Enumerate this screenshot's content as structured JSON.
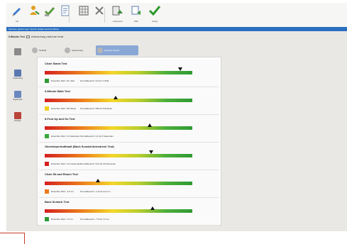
{
  "toolbar": {
    "buttons": [
      {
        "icon": "edit-pencil-icon",
        "label": "Hil",
        "color": "#3f7ccf"
      },
      {
        "icon": "patient-icon",
        "label": "",
        "color": "#e0a020"
      },
      {
        "icon": "select-icon",
        "label": "",
        "color": "#5a9a40"
      },
      {
        "icon": "document-icon",
        "label": "",
        "color": "#6a8ab0"
      },
      {
        "icon": "grid-icon",
        "label": "",
        "color": "#8a8a8a"
      },
      {
        "icon": "close-icon",
        "label": "",
        "color": "#7a7a7a"
      },
      {
        "icon": "assessment-icon",
        "label": "Untersuch.",
        "color": "#3a8a3a"
      },
      {
        "icon": "export-icon",
        "label": "PDF",
        "color": "#5a7ab0"
      },
      {
        "icon": "confirm-check-icon",
        "label": "Fertig",
        "color": "#2e9a2e"
      }
    ]
  },
  "titlebar": {
    "text": "Senioren gestern ago. Test für Heilige Hermine Bauer"
  },
  "recordbar": {
    "icon": "record-icon",
    "label": "6 Minuten Test",
    "subtitle": "Untersuchung zuletzt am heute"
  },
  "sidebar": {
    "items": [
      {
        "label": "",
        "icon": "patient-icon",
        "color": "#8a8a8a"
      },
      {
        "label": "Anwendung",
        "icon": "assessment-icon",
        "color": "#5b78b0"
      },
      {
        "label": "Ergebnisse",
        "icon": "results-icon",
        "color": "#6a88c0"
      },
      {
        "label": "Drucken",
        "icon": "print-icon",
        "color": "#b8443a"
      }
    ]
  },
  "patient_tabs": [
    {
      "label": "Testbild",
      "icon": "person-icon",
      "active": false
    },
    {
      "label": "Auswertung",
      "icon": "chart-icon",
      "active": false
    },
    {
      "label": "Ergebnis Senior",
      "icon": "doc-icon",
      "active": true
    }
  ],
  "tests": [
    {
      "title": "Chair Stand Test",
      "marker": 0.92,
      "marker_dir": "down",
      "swatch": "#2e9a34",
      "current": "Erreichter Wert: 20 mal/s",
      "reference": "Normalbereich: 12 bis 17 Wdh."
    },
    {
      "title": "6-Minute Walk Test",
      "marker": 0.48,
      "marker_dir": "up",
      "swatch": "#f0d020",
      "current": "Erreichter Wert: 504 Meter",
      "reference": "Normalbereich: 400 bis 510 Meter"
    },
    {
      "title": "8-Foot Up and Go Test",
      "marker": 0.71,
      "marker_dir": "up",
      "swatch": "#3aa83c",
      "current": "Erreichter Wert: 4,3 Sekunden",
      "reference": "Normalbereich: 4,4 bis 5 Sekunden"
    },
    {
      "title": "Oberkörperkraftmaß (Back Scratch/Armstreck Test)",
      "marker": 0.72,
      "marker_dir": "down",
      "swatch": "#d42020",
      "current": "Erreichter Wert: 11,4 Sekunden",
      "reference": "Normalbereich: 12,6 bis 20 Sekunden"
    },
    {
      "title": "Chair Sit and Reach Test",
      "marker": 0.36,
      "marker_dir": "up",
      "swatch": "#ec7a1c",
      "current": "Erreichter Wert: -4,5 cm",
      "reference": "Normalbereich: -1,5 bis 12,5 cm"
    },
    {
      "title": "Back Scratch Test",
      "marker": 0.73,
      "marker_dir": "up",
      "swatch": "#2e9a34",
      "current": "Erreichter Wert: 7,5 cm",
      "reference": "Normalbereich: -7,5 bis 7,5 cm"
    }
  ]
}
